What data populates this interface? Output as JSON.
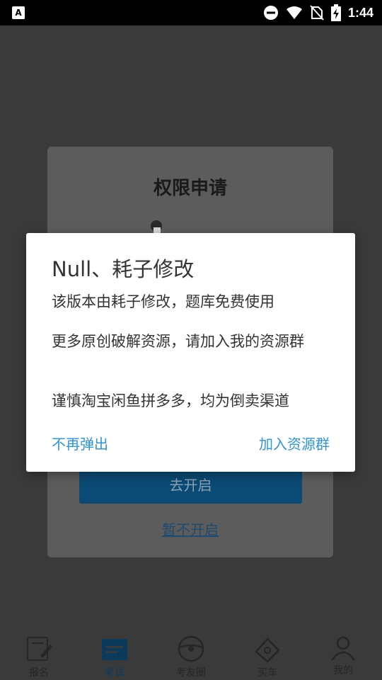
{
  "status_bar": {
    "time": "1:44",
    "icons": [
      "keyboard-a-icon",
      "dnd-icon",
      "wifi-icon",
      "no-sim-icon",
      "battery-charging-icon"
    ]
  },
  "background_page": {
    "permission_card": {
      "title": "权限申请",
      "primary_button": "去开启",
      "secondary_link": "暂不开启"
    },
    "tabs": [
      {
        "label": "报名",
        "icon": "sign-up-icon"
      },
      {
        "label": "考试",
        "icon": "exam-icon",
        "active": true
      },
      {
        "label": "考友圈",
        "icon": "steering-wheel-icon"
      },
      {
        "label": "买车",
        "icon": "car-ticket-icon"
      },
      {
        "label": "我的",
        "icon": "profile-icon"
      }
    ]
  },
  "dialog": {
    "title": "Null、耗子修改",
    "messages": [
      "该版本由耗子修改，题库免费使用",
      "更多原创破解资源，请加入我的资源群",
      "谨慎淘宝闲鱼拼多多，均为倒卖渠道"
    ],
    "negative_button": "不再弹出",
    "positive_button": "加入资源群",
    "accent_color": "#2f95dc"
  }
}
